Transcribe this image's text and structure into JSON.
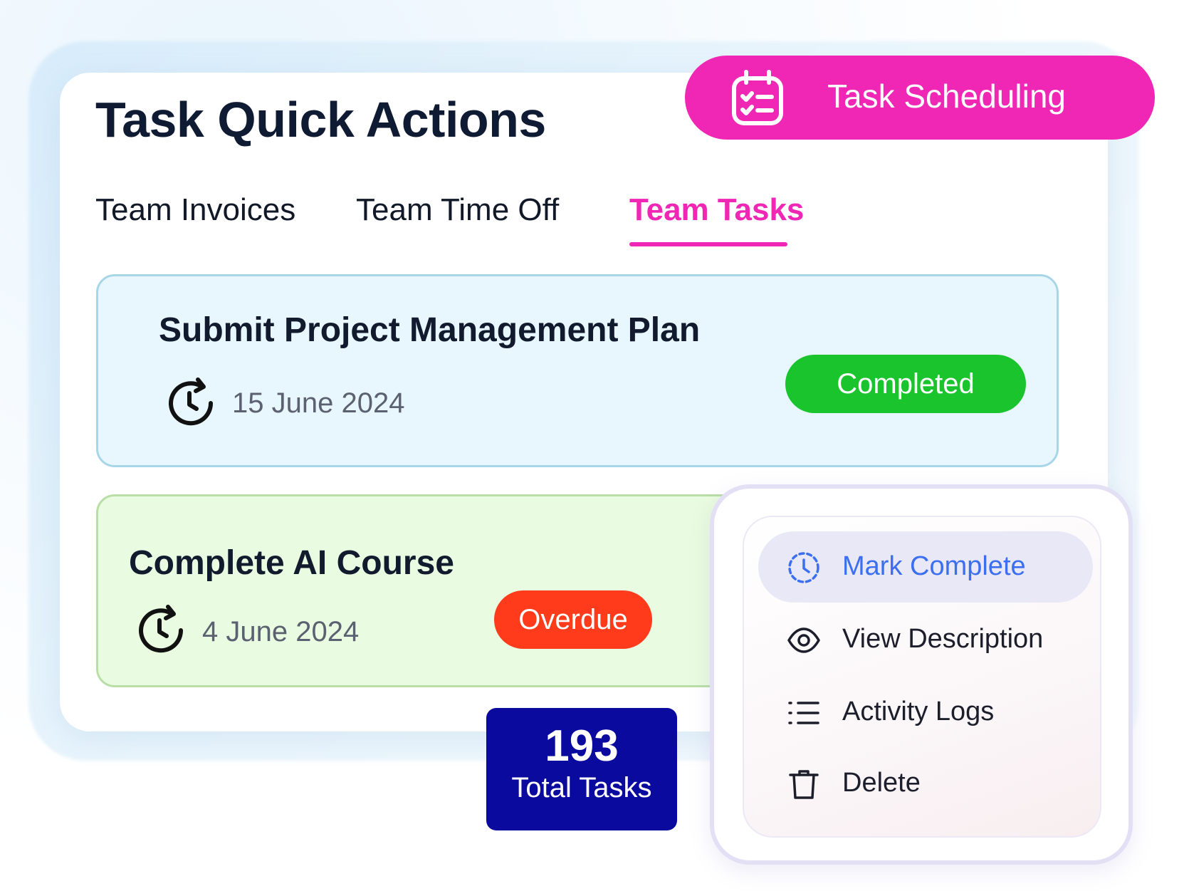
{
  "title": "Task Quick Actions",
  "badge": {
    "label": "Task Scheduling",
    "icon": "calendar-checklist-icon",
    "color": "#ef27b4"
  },
  "tabs": [
    {
      "label": "Team Invoices"
    },
    {
      "label": "Team Time Off"
    },
    {
      "label": "Team Tasks",
      "active": true
    }
  ],
  "tasks": [
    {
      "title": "Submit Project Management Plan",
      "date": "15 June 2024",
      "status": "Completed",
      "status_color": "#1ac42c"
    },
    {
      "title": "Complete AI Course",
      "date": "4 June 2024",
      "status": "Overdue",
      "status_color": "#ff3b1c"
    }
  ],
  "total": {
    "count": "193",
    "label": "Total Tasks"
  },
  "menu": {
    "items": [
      {
        "label": "Mark Complete",
        "icon": "clock-dashed-icon",
        "active": true
      },
      {
        "label": "View Description",
        "icon": "eye-icon"
      },
      {
        "label": "Activity Logs",
        "icon": "list-icon"
      },
      {
        "label": "Delete",
        "icon": "trash-icon"
      }
    ]
  }
}
